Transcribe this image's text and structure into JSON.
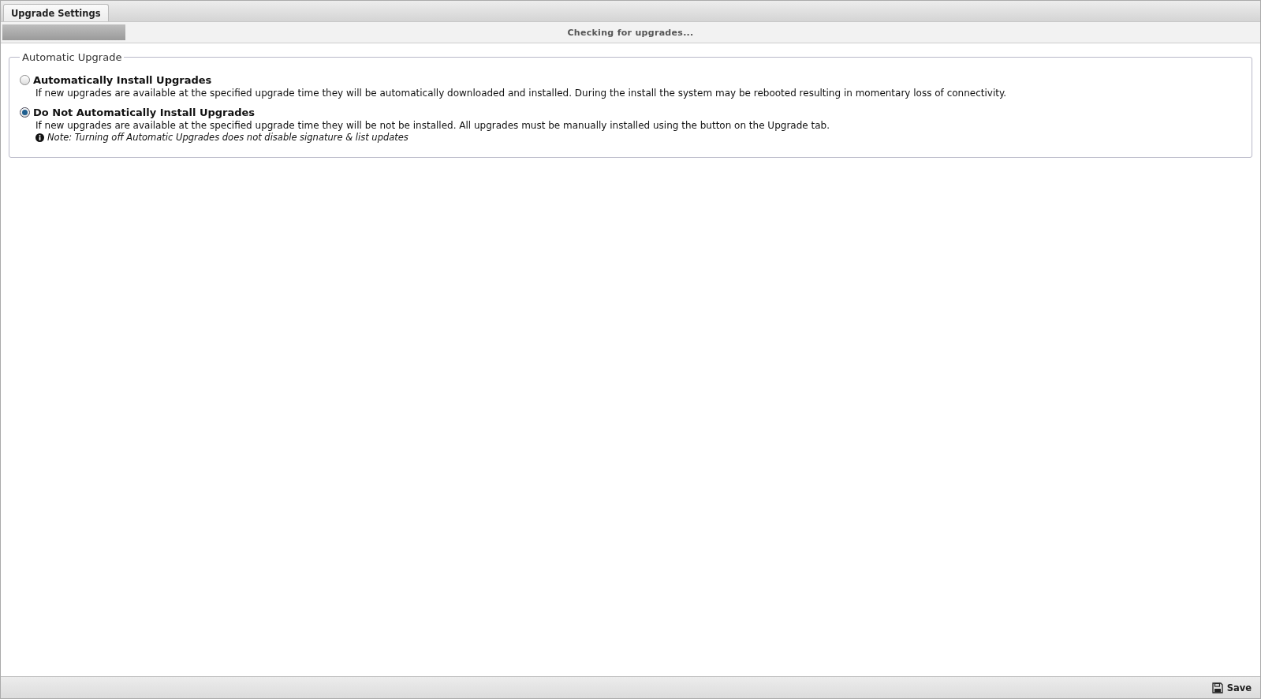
{
  "tabs": [
    {
      "label": "Upgrade Settings",
      "selected": true
    }
  ],
  "progress": {
    "level": 0.098,
    "message": "Checking for upgrades..."
  },
  "fieldset": {
    "legend": "Automatic Upgrade",
    "options": [
      {
        "label": "Automatically Install Upgrades",
        "selected": false,
        "description": "If new upgrades are available at the specified upgrade time they will be automatically downloaded and installed. During the install the system may be rebooted resulting in momentary loss of connectivity."
      },
      {
        "label": "Do Not Automatically Install Upgrades",
        "selected": true,
        "description": "If new upgrades are available at the specified upgrade time they will be not be installed. All upgrades must be manually installed using the button on the Upgrade tab.",
        "note": "Note: Turning off Automatic Upgrades does not disable signature & list updates"
      }
    ]
  },
  "footer": {
    "buttons": [
      {
        "label": "Save",
        "kind": "save"
      }
    ]
  }
}
